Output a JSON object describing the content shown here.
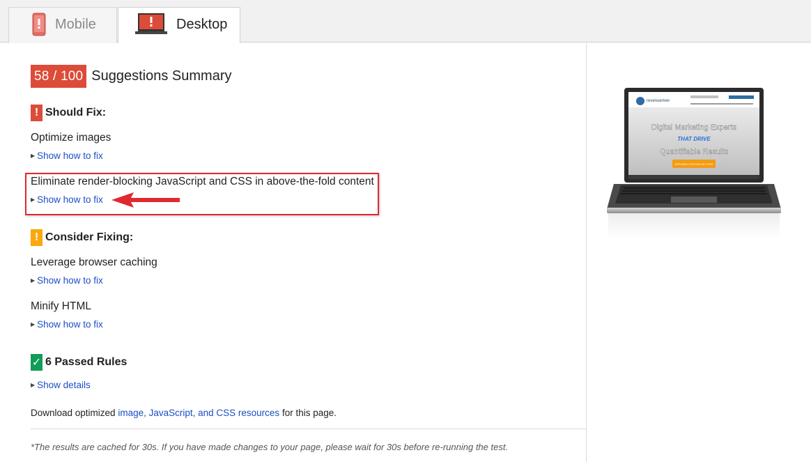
{
  "tabs": [
    {
      "label": "Mobile",
      "active": false
    },
    {
      "label": "Desktop",
      "active": true
    }
  ],
  "summary": {
    "score": "58 / 100",
    "title": "Suggestions Summary"
  },
  "should_fix": {
    "heading": "Should Fix:",
    "rules": [
      {
        "title": "Optimize images",
        "link": "Show how to fix"
      },
      {
        "title": "Eliminate render-blocking JavaScript and CSS in above-the-fold content",
        "link": "Show how to fix"
      }
    ]
  },
  "consider_fixing": {
    "heading": "Consider Fixing:",
    "rules": [
      {
        "title": "Leverage browser caching",
        "link": "Show how to fix"
      },
      {
        "title": "Minify HTML",
        "link": "Show how to fix"
      }
    ]
  },
  "passed": {
    "heading": "6 Passed Rules",
    "link": "Show details"
  },
  "download": {
    "prefix": "Download optimized ",
    "link": "image, JavaScript, and CSS resources",
    "suffix": " for this page."
  },
  "cache_note": "*The results are cached for 30s. If you have made changes to your page, please wait for 30s before re-running the test.",
  "preview": {
    "brand": "revenueriver",
    "headline1": "Digital Marketing Experts",
    "headline2": "THAT DRIVE",
    "headline3": "Quantifiable Results",
    "cta": "EXPLORE A CUSTOM SOLUTION"
  },
  "colors": {
    "score_bg": "#dd4b39",
    "should_fix": "#dd4b39",
    "consider": "#f9a80f",
    "passed": "#0f9d58",
    "link": "#1a4ec6",
    "annotation": "#e0292e"
  }
}
